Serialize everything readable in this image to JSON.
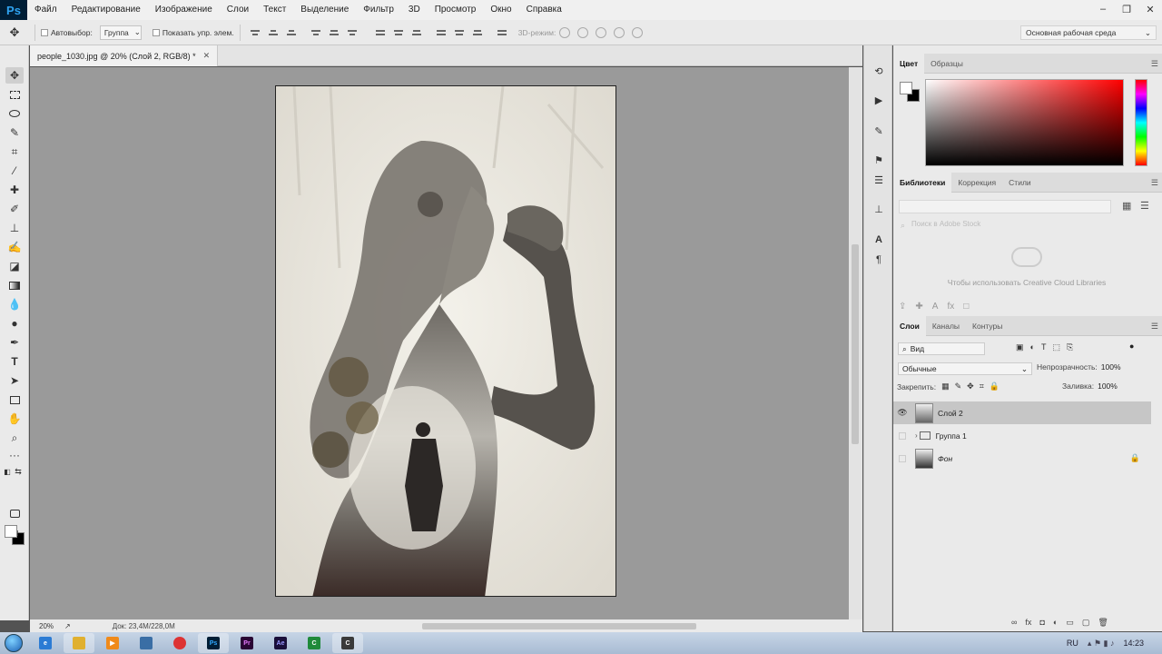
{
  "app": {
    "logo": "Ps",
    "menu": [
      "Файл",
      "Редактирование",
      "Изображение",
      "Слои",
      "Текст",
      "Выделение",
      "Фильтр",
      "3D",
      "Просмотр",
      "Окно",
      "Справка"
    ]
  },
  "options": {
    "autoselect_label": "Автовыбор:",
    "autoselect_value": "Группа",
    "show_transform_label": "Показать упр. элем.",
    "mode3d_label": "3D-режим:",
    "workspace": "Основная рабочая среда"
  },
  "document": {
    "tab_title": "people_1030.jpg @ 20% (Слой 2, RGB/8) *",
    "zoom": "20%",
    "doc_info": "Док: 23,4M/228,0M"
  },
  "color_panel": {
    "tabs": [
      "Цвет",
      "Образцы"
    ],
    "hue_color": "#ff0000"
  },
  "libraries_panel": {
    "tabs": [
      "Библиотеки",
      "Коррекция",
      "Стили"
    ],
    "search_placeholder": "Поиск в Adobe Stock",
    "message": "Чтобы использовать Creative Cloud Libraries"
  },
  "layers_panel": {
    "tabs": [
      "Слои",
      "Каналы",
      "Контуры"
    ],
    "filter_label": "Вид",
    "blend_mode": "Обычные",
    "opacity_label": "Непрозрачность:",
    "opacity_value": "100%",
    "lock_label": "Закрепить:",
    "fill_label": "Заливка:",
    "fill_value": "100%",
    "layers": [
      {
        "name": "Слой 2",
        "visible": true,
        "selected": true
      },
      {
        "name": "Группа 1",
        "visible": false,
        "selected": false,
        "type": "group"
      },
      {
        "name": "Фон",
        "visible": false,
        "selected": false,
        "locked": true
      }
    ]
  },
  "taskbar": {
    "lang": "RU",
    "time": "14:23"
  }
}
